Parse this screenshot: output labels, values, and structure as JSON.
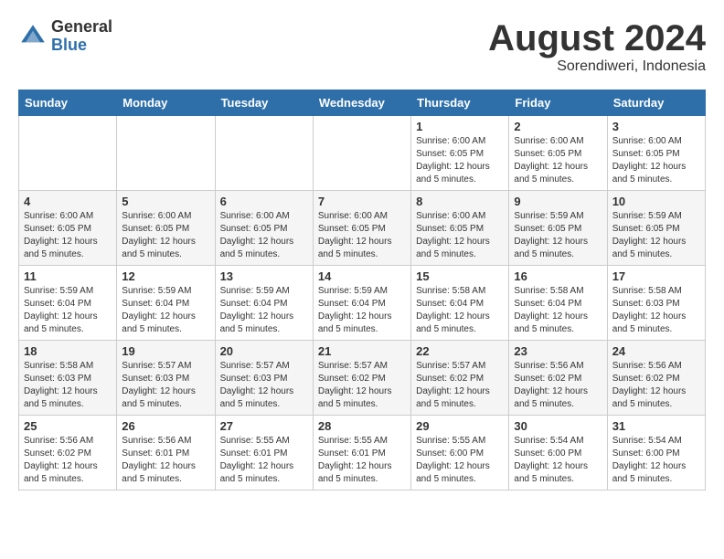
{
  "logo": {
    "general": "General",
    "blue": "Blue"
  },
  "title": {
    "month_year": "August 2024",
    "location": "Sorendiweri, Indonesia"
  },
  "weekdays": [
    "Sunday",
    "Monday",
    "Tuesday",
    "Wednesday",
    "Thursday",
    "Friday",
    "Saturday"
  ],
  "weeks": [
    [
      {
        "day": "",
        "sunrise": "",
        "sunset": "",
        "daylight": ""
      },
      {
        "day": "",
        "sunrise": "",
        "sunset": "",
        "daylight": ""
      },
      {
        "day": "",
        "sunrise": "",
        "sunset": "",
        "daylight": ""
      },
      {
        "day": "",
        "sunrise": "",
        "sunset": "",
        "daylight": ""
      },
      {
        "day": "1",
        "sunrise": "Sunrise: 6:00 AM",
        "sunset": "Sunset: 6:05 PM",
        "daylight": "Daylight: 12 hours and 5 minutes."
      },
      {
        "day": "2",
        "sunrise": "Sunrise: 6:00 AM",
        "sunset": "Sunset: 6:05 PM",
        "daylight": "Daylight: 12 hours and 5 minutes."
      },
      {
        "day": "3",
        "sunrise": "Sunrise: 6:00 AM",
        "sunset": "Sunset: 6:05 PM",
        "daylight": "Daylight: 12 hours and 5 minutes."
      }
    ],
    [
      {
        "day": "4",
        "sunrise": "Sunrise: 6:00 AM",
        "sunset": "Sunset: 6:05 PM",
        "daylight": "Daylight: 12 hours and 5 minutes."
      },
      {
        "day": "5",
        "sunrise": "Sunrise: 6:00 AM",
        "sunset": "Sunset: 6:05 PM",
        "daylight": "Daylight: 12 hours and 5 minutes."
      },
      {
        "day": "6",
        "sunrise": "Sunrise: 6:00 AM",
        "sunset": "Sunset: 6:05 PM",
        "daylight": "Daylight: 12 hours and 5 minutes."
      },
      {
        "day": "7",
        "sunrise": "Sunrise: 6:00 AM",
        "sunset": "Sunset: 6:05 PM",
        "daylight": "Daylight: 12 hours and 5 minutes."
      },
      {
        "day": "8",
        "sunrise": "Sunrise: 6:00 AM",
        "sunset": "Sunset: 6:05 PM",
        "daylight": "Daylight: 12 hours and 5 minutes."
      },
      {
        "day": "9",
        "sunrise": "Sunrise: 5:59 AM",
        "sunset": "Sunset: 6:05 PM",
        "daylight": "Daylight: 12 hours and 5 minutes."
      },
      {
        "day": "10",
        "sunrise": "Sunrise: 5:59 AM",
        "sunset": "Sunset: 6:05 PM",
        "daylight": "Daylight: 12 hours and 5 minutes."
      }
    ],
    [
      {
        "day": "11",
        "sunrise": "Sunrise: 5:59 AM",
        "sunset": "Sunset: 6:04 PM",
        "daylight": "Daylight: 12 hours and 5 minutes."
      },
      {
        "day": "12",
        "sunrise": "Sunrise: 5:59 AM",
        "sunset": "Sunset: 6:04 PM",
        "daylight": "Daylight: 12 hours and 5 minutes."
      },
      {
        "day": "13",
        "sunrise": "Sunrise: 5:59 AM",
        "sunset": "Sunset: 6:04 PM",
        "daylight": "Daylight: 12 hours and 5 minutes."
      },
      {
        "day": "14",
        "sunrise": "Sunrise: 5:59 AM",
        "sunset": "Sunset: 6:04 PM",
        "daylight": "Daylight: 12 hours and 5 minutes."
      },
      {
        "day": "15",
        "sunrise": "Sunrise: 5:58 AM",
        "sunset": "Sunset: 6:04 PM",
        "daylight": "Daylight: 12 hours and 5 minutes."
      },
      {
        "day": "16",
        "sunrise": "Sunrise: 5:58 AM",
        "sunset": "Sunset: 6:04 PM",
        "daylight": "Daylight: 12 hours and 5 minutes."
      },
      {
        "day": "17",
        "sunrise": "Sunrise: 5:58 AM",
        "sunset": "Sunset: 6:03 PM",
        "daylight": "Daylight: 12 hours and 5 minutes."
      }
    ],
    [
      {
        "day": "18",
        "sunrise": "Sunrise: 5:58 AM",
        "sunset": "Sunset: 6:03 PM",
        "daylight": "Daylight: 12 hours and 5 minutes."
      },
      {
        "day": "19",
        "sunrise": "Sunrise: 5:57 AM",
        "sunset": "Sunset: 6:03 PM",
        "daylight": "Daylight: 12 hours and 5 minutes."
      },
      {
        "day": "20",
        "sunrise": "Sunrise: 5:57 AM",
        "sunset": "Sunset: 6:03 PM",
        "daylight": "Daylight: 12 hours and 5 minutes."
      },
      {
        "day": "21",
        "sunrise": "Sunrise: 5:57 AM",
        "sunset": "Sunset: 6:02 PM",
        "daylight": "Daylight: 12 hours and 5 minutes."
      },
      {
        "day": "22",
        "sunrise": "Sunrise: 5:57 AM",
        "sunset": "Sunset: 6:02 PM",
        "daylight": "Daylight: 12 hours and 5 minutes."
      },
      {
        "day": "23",
        "sunrise": "Sunrise: 5:56 AM",
        "sunset": "Sunset: 6:02 PM",
        "daylight": "Daylight: 12 hours and 5 minutes."
      },
      {
        "day": "24",
        "sunrise": "Sunrise: 5:56 AM",
        "sunset": "Sunset: 6:02 PM",
        "daylight": "Daylight: 12 hours and 5 minutes."
      }
    ],
    [
      {
        "day": "25",
        "sunrise": "Sunrise: 5:56 AM",
        "sunset": "Sunset: 6:02 PM",
        "daylight": "Daylight: 12 hours and 5 minutes."
      },
      {
        "day": "26",
        "sunrise": "Sunrise: 5:56 AM",
        "sunset": "Sunset: 6:01 PM",
        "daylight": "Daylight: 12 hours and 5 minutes."
      },
      {
        "day": "27",
        "sunrise": "Sunrise: 5:55 AM",
        "sunset": "Sunset: 6:01 PM",
        "daylight": "Daylight: 12 hours and 5 minutes."
      },
      {
        "day": "28",
        "sunrise": "Sunrise: 5:55 AM",
        "sunset": "Sunset: 6:01 PM",
        "daylight": "Daylight: 12 hours and 5 minutes."
      },
      {
        "day": "29",
        "sunrise": "Sunrise: 5:55 AM",
        "sunset": "Sunset: 6:00 PM",
        "daylight": "Daylight: 12 hours and 5 minutes."
      },
      {
        "day": "30",
        "sunrise": "Sunrise: 5:54 AM",
        "sunset": "Sunset: 6:00 PM",
        "daylight": "Daylight: 12 hours and 5 minutes."
      },
      {
        "day": "31",
        "sunrise": "Sunrise: 5:54 AM",
        "sunset": "Sunset: 6:00 PM",
        "daylight": "Daylight: 12 hours and 5 minutes."
      }
    ]
  ]
}
